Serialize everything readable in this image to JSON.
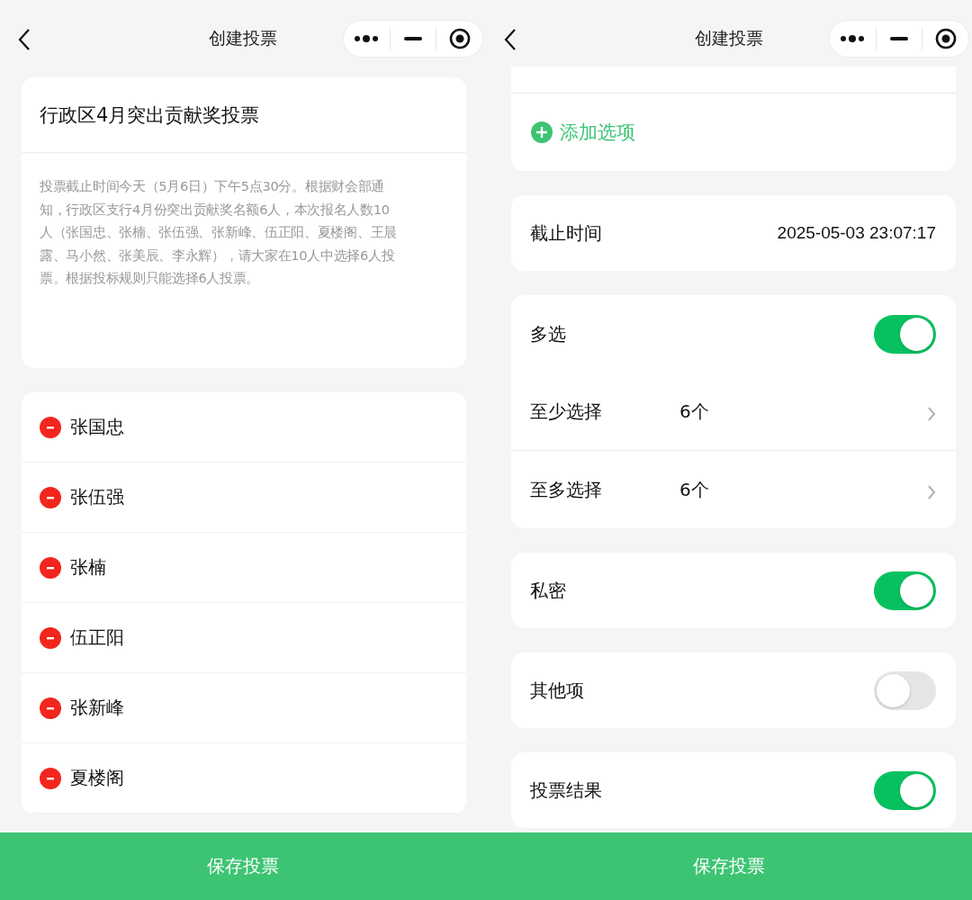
{
  "screens": [
    {
      "nav": {
        "title": "创建投票"
      },
      "poll": {
        "title": "行政区4月突出贡献奖投票",
        "description": "投票截止时间今天（5月6日）下午5点30分。根据财会部通知，行政区支行4月份突出贡献奖名额6人，本次报名人数10人（张国忠、张楠、张伍强、张新峰、伍正阳、夏楼阁、王晨露、马小然、张美辰、李永辉），请大家在10人中选择6人投票。根据投标规则只能选择6人投票。"
      },
      "options": [
        {
          "name": "张国忠"
        },
        {
          "name": "张伍强"
        },
        {
          "name": "张楠"
        },
        {
          "name": "伍正阳"
        },
        {
          "name": "张新峰"
        },
        {
          "name": "夏楼阁"
        }
      ],
      "save_button": "保存投票"
    },
    {
      "nav": {
        "title": "创建投票"
      },
      "add_option": "添加选项",
      "groups": [
        [
          {
            "kind": "value",
            "label": "截止时间",
            "value": "2025-05-03 23:07:17"
          }
        ],
        [
          {
            "kind": "toggle",
            "label": "多选",
            "on": true
          },
          {
            "kind": "select",
            "label": "至少选择",
            "value": "6个"
          },
          {
            "kind": "select",
            "label": "至多选择",
            "value": "6个"
          }
        ],
        [
          {
            "kind": "toggle",
            "label": "私密",
            "on": true
          }
        ],
        [
          {
            "kind": "toggle",
            "label": "其他项",
            "on": false
          }
        ],
        [
          {
            "kind": "toggle",
            "label": "投票结果",
            "on": true
          }
        ]
      ],
      "save_button": "保存投票"
    }
  ]
}
